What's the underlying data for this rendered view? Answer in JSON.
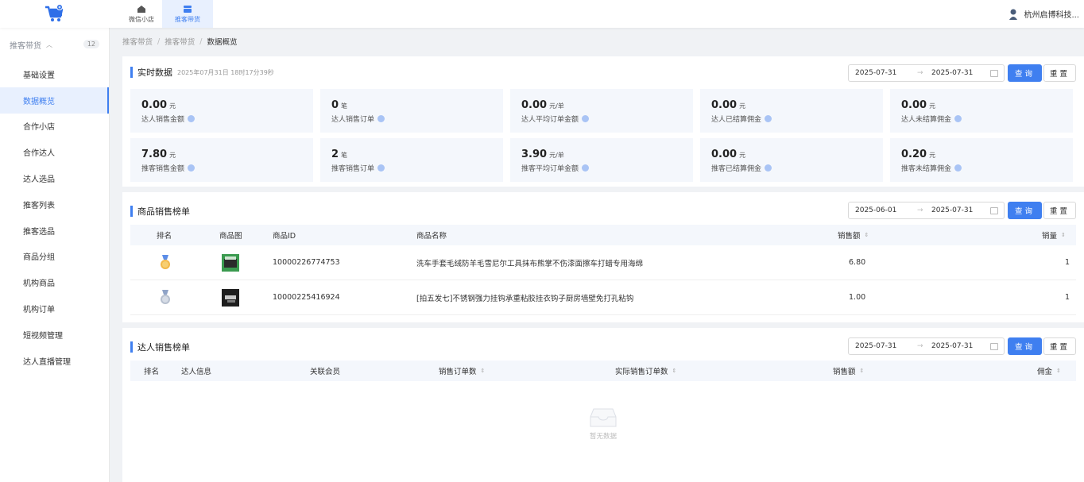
{
  "top_nav": [
    {
      "label": "微信小店",
      "icon": "home-icon"
    },
    {
      "label": "推客带货",
      "icon": "store-icon"
    }
  ],
  "user": {
    "name": "杭州启博科技..."
  },
  "sidebar": {
    "group_label": "推客带货",
    "group_badge": "12",
    "items": [
      {
        "label": "基础设置"
      },
      {
        "label": "数据概览"
      },
      {
        "label": "合作小店"
      },
      {
        "label": "合作达人"
      },
      {
        "label": "达人选品"
      },
      {
        "label": "推客列表"
      },
      {
        "label": "推客选品"
      },
      {
        "label": "商品分组"
      },
      {
        "label": "机构商品"
      },
      {
        "label": "机构订单"
      },
      {
        "label": "短视频管理"
      },
      {
        "label": "达人直播管理"
      }
    ]
  },
  "breadcrumb": [
    "推客带货",
    "推客带货",
    "数据概览"
  ],
  "buttons": {
    "query": "查询",
    "reset": "重置"
  },
  "realtime": {
    "title": "实时数据",
    "timestamp": "2025年07月31日 18时17分39秒",
    "date_start": "2025-07-31",
    "date_end": "2025-07-31",
    "stats": [
      {
        "value": "0.00",
        "unit": "元",
        "label": "达人销售金额"
      },
      {
        "value": "0",
        "unit": "笔",
        "label": "达人销售订单"
      },
      {
        "value": "0.00",
        "unit": "元/单",
        "label": "达人平均订单金额"
      },
      {
        "value": "0.00",
        "unit": "元",
        "label": "达人已结算佣金"
      },
      {
        "value": "0.00",
        "unit": "元",
        "label": "达人未结算佣金"
      },
      {
        "value": "7.80",
        "unit": "元",
        "label": "推客销售金额"
      },
      {
        "value": "2",
        "unit": "笔",
        "label": "推客销售订单"
      },
      {
        "value": "3.90",
        "unit": "元/单",
        "label": "推客平均订单金额"
      },
      {
        "value": "0.00",
        "unit": "元",
        "label": "推客已结算佣金"
      },
      {
        "value": "0.20",
        "unit": "元",
        "label": "推客未结算佣金"
      }
    ]
  },
  "product_rank": {
    "title": "商品销售榜单",
    "date_start": "2025-06-01",
    "date_end": "2025-07-31",
    "columns": {
      "rank": "排名",
      "image": "商品图",
      "id": "商品ID",
      "name": "商品名称",
      "sales_amount": "销售额",
      "sales_qty": "销量"
    },
    "rows": [
      {
        "rank": "1",
        "id": "10000226774753",
        "name": "洗车手套毛绒防羊毛雪尼尔工具抹布熊掌不伤漆面擦车打蜡专用海绵",
        "sales_amount": "6.80",
        "sales_qty": "1"
      },
      {
        "rank": "2",
        "id": "10000225416924",
        "name": "[拍五发七]不锈钢强力挂钩承重粘胶挂衣钩子厨房墙壁免打孔粘钩",
        "sales_amount": "1.00",
        "sales_qty": "1"
      }
    ]
  },
  "talent_rank": {
    "title": "达人销售榜单",
    "date_start": "2025-07-31",
    "date_end": "2025-07-31",
    "columns": {
      "rank": "排名",
      "info": "达人信息",
      "member": "关联会员",
      "orders": "销售订单数",
      "actual_orders": "实际销售订单数",
      "amount": "销售额",
      "commission": "佣金"
    },
    "empty_text": "暂无数据"
  },
  "colors": {
    "accent": "#3f7ff0",
    "stat_bg": "#f4f7fc",
    "page_bg": "#f0f2f5"
  }
}
